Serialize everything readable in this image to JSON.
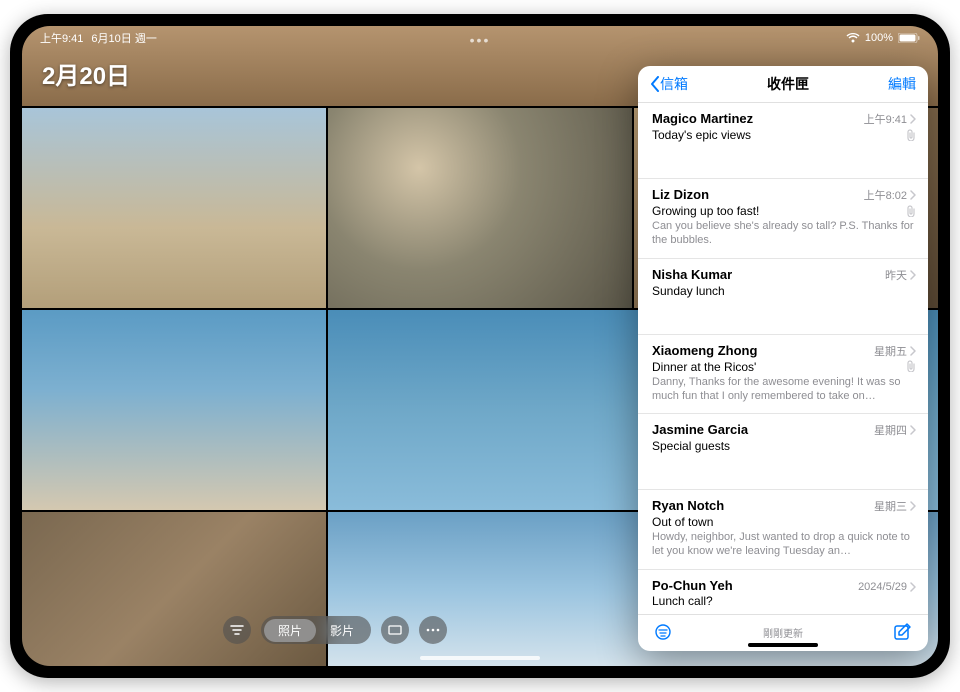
{
  "status": {
    "time": "上午9:41",
    "date": "6月10日 週一",
    "battery_pct": "100%"
  },
  "photos": {
    "date_header": "2月20日",
    "segments": {
      "photos": "照片",
      "videos": "影片"
    }
  },
  "mail": {
    "back_label": "信箱",
    "title": "收件匣",
    "edit_label": "編輯",
    "footer_status": "剛剛更新",
    "messages": [
      {
        "sender": "Magico Martinez",
        "time": "上午9:41",
        "subject": "Today's epic views",
        "preview": "",
        "attachment": true
      },
      {
        "sender": "Liz Dizon",
        "time": "上午8:02",
        "subject": "Growing up too fast!",
        "preview": "Can you believe she's already so tall? P.S. Thanks for the bubbles.",
        "attachment": true
      },
      {
        "sender": "Nisha Kumar",
        "time": "昨天",
        "subject": "Sunday lunch",
        "preview": "",
        "attachment": false
      },
      {
        "sender": "Xiaomeng Zhong",
        "time": "星期五",
        "subject": "Dinner at the Ricos'",
        "preview": "Danny, Thanks for the awesome evening! It was so much fun that I only remembered to take on…",
        "attachment": true
      },
      {
        "sender": "Jasmine Garcia",
        "time": "星期四",
        "subject": "Special guests",
        "preview": "",
        "attachment": false
      },
      {
        "sender": "Ryan Notch",
        "time": "星期三",
        "subject": "Out of town",
        "preview": "Howdy, neighbor, Just wanted to drop a quick note to let you know we're leaving Tuesday an…",
        "attachment": false
      },
      {
        "sender": "Po-Chun Yeh",
        "time": "2024/5/29",
        "subject": "Lunch call?",
        "preview": "",
        "attachment": false
      }
    ]
  }
}
